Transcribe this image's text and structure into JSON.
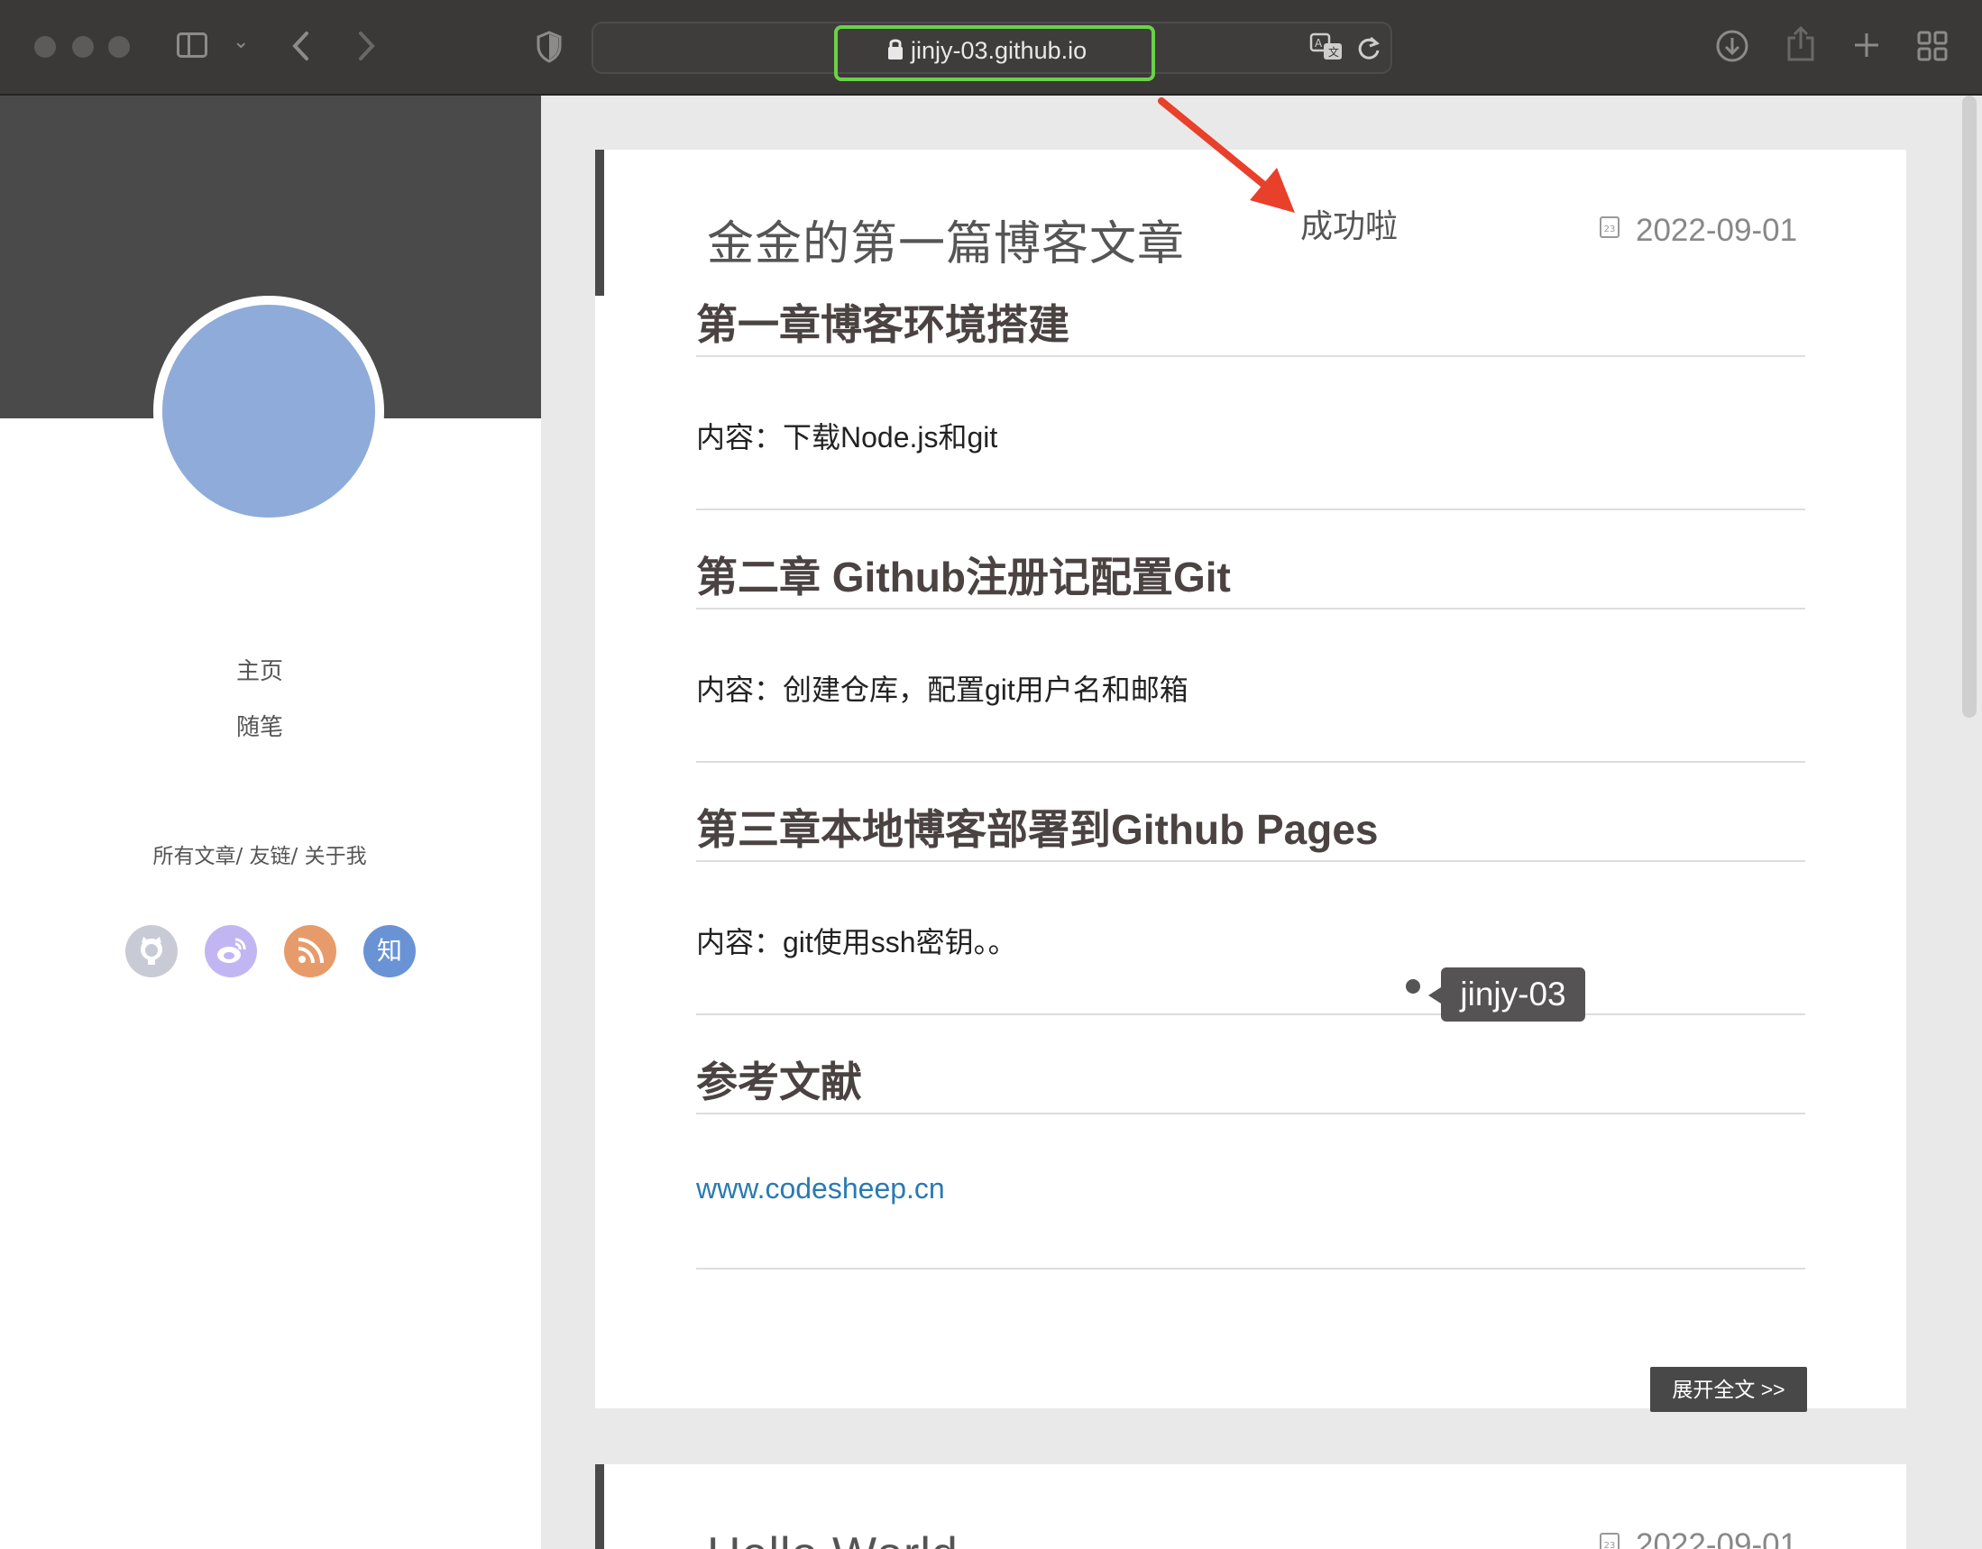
{
  "browser": {
    "url": "jinjy-03.github.io",
    "icons": {
      "sidebar": "sidebar-icon",
      "back": "chevron-left-icon",
      "forward": "chevron-right-icon",
      "shield": "shield-icon",
      "lock": "lock-icon",
      "translate": "translate-icon",
      "reload": "reload-icon",
      "download": "download-icon",
      "share": "share-icon",
      "new_tab": "plus-icon",
      "tabs": "tab-overview-icon"
    },
    "highlight_color": "#6bd148"
  },
  "sidebar": {
    "nav": [
      "主页",
      "随笔"
    ],
    "links": [
      "所有文章",
      "友链",
      "关于我"
    ],
    "social": [
      {
        "name": "github-icon",
        "glyph": "",
        "color": "#c8cbd6"
      },
      {
        "name": "weibo-icon",
        "glyph": "",
        "color": "#c2b6f2"
      },
      {
        "name": "rss-icon",
        "glyph": "",
        "color": "#e89b6a"
      },
      {
        "name": "zhihu-icon",
        "glyph": "知",
        "color": "#6a93d6"
      }
    ]
  },
  "annotation": {
    "text": "成功啦",
    "arrow_color": "#e8402b"
  },
  "posts": [
    {
      "title": "金金的第一篇博客文章",
      "date": "2022-09-01",
      "sections": [
        {
          "heading": "第一章博客环境搭建",
          "content": "内容：下载Node.js和git"
        },
        {
          "heading": "第二章 Github注册记配置Git",
          "content": "内容：创建仓库，配置git用户名和邮箱"
        },
        {
          "heading": "第三章本地博客部署到Github Pages",
          "content": "内容：git使用ssh密钥。。"
        },
        {
          "heading": "参考文献",
          "link": "www.codesheep.cn"
        }
      ],
      "more_label": "展开全文 >>"
    },
    {
      "title": "Hello World",
      "date": "2022-09-01"
    }
  ],
  "tooltip": "jinjy-03"
}
